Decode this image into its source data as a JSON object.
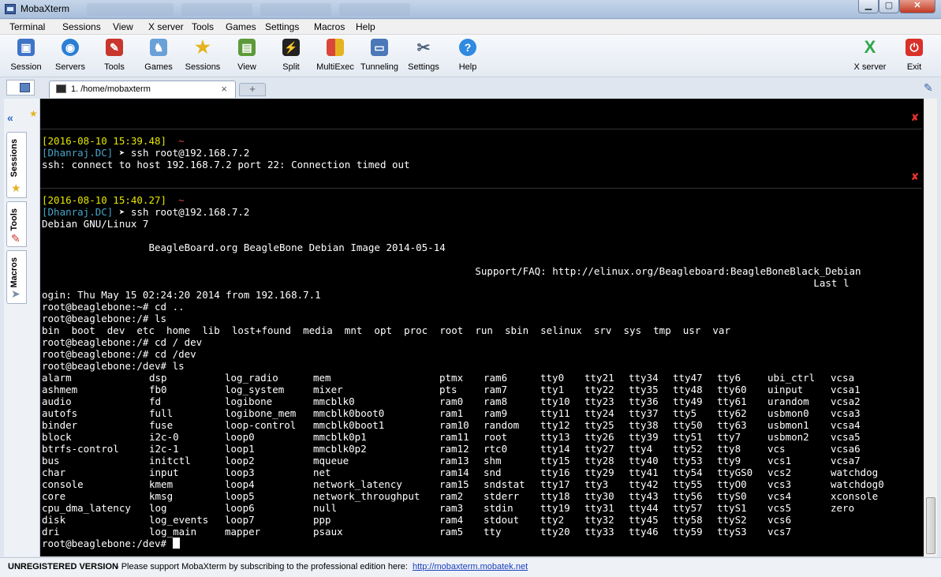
{
  "window": {
    "title": "MobaXterm"
  },
  "menu": [
    "Terminal",
    "Sessions",
    "View",
    "X server",
    "Tools",
    "Games",
    "Settings",
    "Macros",
    "Help"
  ],
  "toolbar": {
    "items": [
      {
        "label": "Session",
        "icon": "session-icon",
        "color": "#3f74c7"
      },
      {
        "label": "Servers",
        "icon": "servers-icon",
        "color": "#2b7fd4"
      },
      {
        "label": "Tools",
        "icon": "tools-icon",
        "color": "#c8362e"
      },
      {
        "label": "Games",
        "icon": "games-icon",
        "color": "#6aa0d8"
      },
      {
        "label": "Sessions",
        "icon": "star-icon",
        "color": "#e5b320"
      },
      {
        "label": "View",
        "icon": "view-icon",
        "color": "#5c9a3a"
      },
      {
        "label": "Split",
        "icon": "split-icon",
        "color": "#222222"
      },
      {
        "label": "MultiExec",
        "icon": "multiexec-icon",
        "color": "#d9473a"
      },
      {
        "label": "Tunneling",
        "icon": "tunneling-icon",
        "color": "#4a78b8"
      },
      {
        "label": "Settings",
        "icon": "settings-icon",
        "color": "#7d8da3"
      },
      {
        "label": "Help",
        "icon": "help-icon",
        "color": "#2f8ae0"
      }
    ],
    "right": [
      {
        "label": "X server",
        "icon": "x-server-icon",
        "color": "#2ea84a"
      },
      {
        "label": "Exit",
        "icon": "exit-icon",
        "color": "#d9302a"
      }
    ]
  },
  "tabs": {
    "active_label": "1. /home/mobaxterm",
    "close": "×",
    "new": "+"
  },
  "side_tabs": [
    "Sessions",
    "Tools",
    "Macros"
  ],
  "terminal": {
    "block1": {
      "timestamp": "[2016-08-10 15:39.48]",
      "tilde": "~",
      "user": "[Dhanraj.DC]",
      "cmd": " ➤ ssh root@192.168.7.2",
      "out": "ssh: connect to host 192.168.7.2 port 22: Connection timed out"
    },
    "block2": {
      "timestamp": "[2016-08-10 15:40.27]",
      "tilde": "~",
      "user": "[Dhanraj.DC]",
      "cmd": " ➤ ssh root@192.168.7.2"
    },
    "lines": [
      "Debian GNU/Linux 7",
      "",
      "                  BeagleBoard.org BeagleBone Debian Image 2014-05-14",
      "",
      "                                                                         Support/FAQ: http://elinux.org/Beagleboard:BeagleBoneBlack_Debian",
      "                                                                                                                                  Last l",
      "ogin: Thu May 15 02:24:20 2014 from 192.168.7.1",
      "root@beaglebone:~# cd ..",
      "root@beaglebone:/# ls",
      "bin  boot  dev  etc  home  lib  lost+found  media  mnt  opt  proc  root  run  sbin  selinux  srv  sys  tmp  usr  var",
      "root@beaglebone:/# cd / dev",
      "root@beaglebone:/# cd /dev",
      "root@beaglebone:/dev# ls"
    ],
    "ls_columns": [
      [
        "alarm",
        "ashmem",
        "audio",
        "autofs",
        "binder",
        "block",
        "btrfs-control",
        "bus",
        "char",
        "console",
        "core",
        "cpu_dma_latency",
        "disk",
        "dri"
      ],
      [
        "dsp",
        "fb0",
        "fd",
        "full",
        "fuse",
        "i2c-0",
        "i2c-1",
        "initctl",
        "input",
        "kmem",
        "kmsg",
        "log",
        "log_events",
        "log_main"
      ],
      [
        "log_radio",
        "log_system",
        "logibone",
        "logibone_mem",
        "loop-control",
        "loop0",
        "loop1",
        "loop2",
        "loop3",
        "loop4",
        "loop5",
        "loop6",
        "loop7",
        "mapper"
      ],
      [
        "mem",
        "mixer",
        "mmcblk0",
        "mmcblk0boot0",
        "mmcblk0boot1",
        "mmcblk0p1",
        "mmcblk0p2",
        "mqueue",
        "net",
        "network_latency",
        "network_throughput",
        "null",
        "ppp",
        "psaux"
      ],
      [
        "ptmx",
        "pts",
        "ram0",
        "ram1",
        "ram10",
        "ram11",
        "ram12",
        "ram13",
        "ram14",
        "ram15",
        "ram2",
        "ram3",
        "ram4",
        "ram5"
      ],
      [
        "ram6",
        "ram7",
        "ram8",
        "ram9",
        "random",
        "root",
        "rtc0",
        "shm",
        "snd",
        "sndstat",
        "stderr",
        "stdin",
        "stdout",
        "tty"
      ],
      [
        "tty0",
        "tty1",
        "tty10",
        "tty11",
        "tty12",
        "tty13",
        "tty14",
        "tty15",
        "tty16",
        "tty17",
        "tty18",
        "tty19",
        "tty2",
        "tty20"
      ],
      [
        "tty21",
        "tty22",
        "tty23",
        "tty24",
        "tty25",
        "tty26",
        "tty27",
        "tty28",
        "tty29",
        "tty3",
        "tty30",
        "tty31",
        "tty32",
        "tty33"
      ],
      [
        "tty34",
        "tty35",
        "tty36",
        "tty37",
        "tty38",
        "tty39",
        "tty4",
        "tty40",
        "tty41",
        "tty42",
        "tty43",
        "tty44",
        "tty45",
        "tty46"
      ],
      [
        "tty47",
        "tty48",
        "tty49",
        "tty5",
        "tty50",
        "tty51",
        "tty52",
        "tty53",
        "tty54",
        "tty55",
        "tty56",
        "tty57",
        "tty58",
        "tty59"
      ],
      [
        "tty6",
        "tty60",
        "tty61",
        "tty62",
        "tty63",
        "tty7",
        "tty8",
        "tty9",
        "ttyGS0",
        "ttyO0",
        "ttyS0",
        "ttyS1",
        "ttyS2",
        "ttyS3"
      ],
      [
        "ubi_ctrl",
        "uinput",
        "urandom",
        "usbmon0",
        "usbmon1",
        "usbmon2",
        "vcs",
        "vcs1",
        "vcs2",
        "vcs3",
        "vcs4",
        "vcs5",
        "vcs6",
        "vcs7"
      ],
      [
        "vcsa",
        "vcsa1",
        "vcsa2",
        "vcsa3",
        "vcsa4",
        "vcsa5",
        "vcsa6",
        "vcsa7",
        "watchdog",
        "watchdog0",
        "xconsole",
        "zero",
        "",
        ""
      ]
    ],
    "final_prompt": "root@beaglebone:/dev# "
  },
  "status": {
    "bold": "UNREGISTERED VERSION",
    "message": " -  Please support MobaXterm by subscribing to the professional edition here:",
    "link": "http://mobaxterm.mobatek.net"
  }
}
